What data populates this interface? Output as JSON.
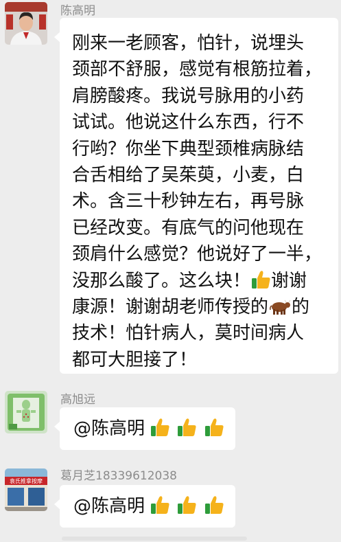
{
  "messages": [
    {
      "sender": "陈高明",
      "avatar_icon": "doctor-portrait-avatar",
      "lines": [
        {
          "text": "刚来一老顾客，怕针，说埋头"
        },
        {
          "text": "颈部不舒服，感觉有根筋拉着，"
        },
        {
          "text": "肩膀酸疼。我说号脉用的小药"
        },
        {
          "text": "试试。他说这什么东西，行不"
        },
        {
          "text": "行哟？你坐下典型颈椎病脉结"
        },
        {
          "text": "合舌相给了吴茱萸，小麦，白"
        },
        {
          "text": "术。含三十秒钟左右，再号脉"
        },
        {
          "text": "已经改变。有底气的问他现在"
        },
        {
          "text": "颈肩什么感觉？他说好了一半，"
        },
        {
          "text": "没那么酸了。这么块！",
          "emoji": "thumbs-up-icon",
          "after": "谢谢"
        },
        {
          "text": "康源！谢谢胡老师传授的",
          "emoji": "ox-icon",
          "after": "的"
        },
        {
          "text": "技术！怕针病人，莫时间病人"
        },
        {
          "text": "都可大胆接了！"
        }
      ]
    },
    {
      "sender": "高旭远",
      "avatar_icon": "acupoint-chart-avatar",
      "mention": "@陈高明",
      "emojis": [
        "thumbs-up-icon",
        "thumbs-up-icon",
        "thumbs-up-icon"
      ]
    },
    {
      "sender": "葛月芝18339612038",
      "avatar_icon": "storefront-avatar",
      "avatar_sign_text": "袁氏推拿按摩",
      "mention": "@陈高明",
      "emojis": [
        "thumbs-up-icon",
        "thumbs-up-icon",
        "thumbs-up-icon"
      ]
    }
  ],
  "colors": {
    "background": "#ededed",
    "bubble": "#ffffff",
    "sender_name": "#8c8c8c",
    "text": "#111111",
    "thumb": "#f5b21b"
  }
}
